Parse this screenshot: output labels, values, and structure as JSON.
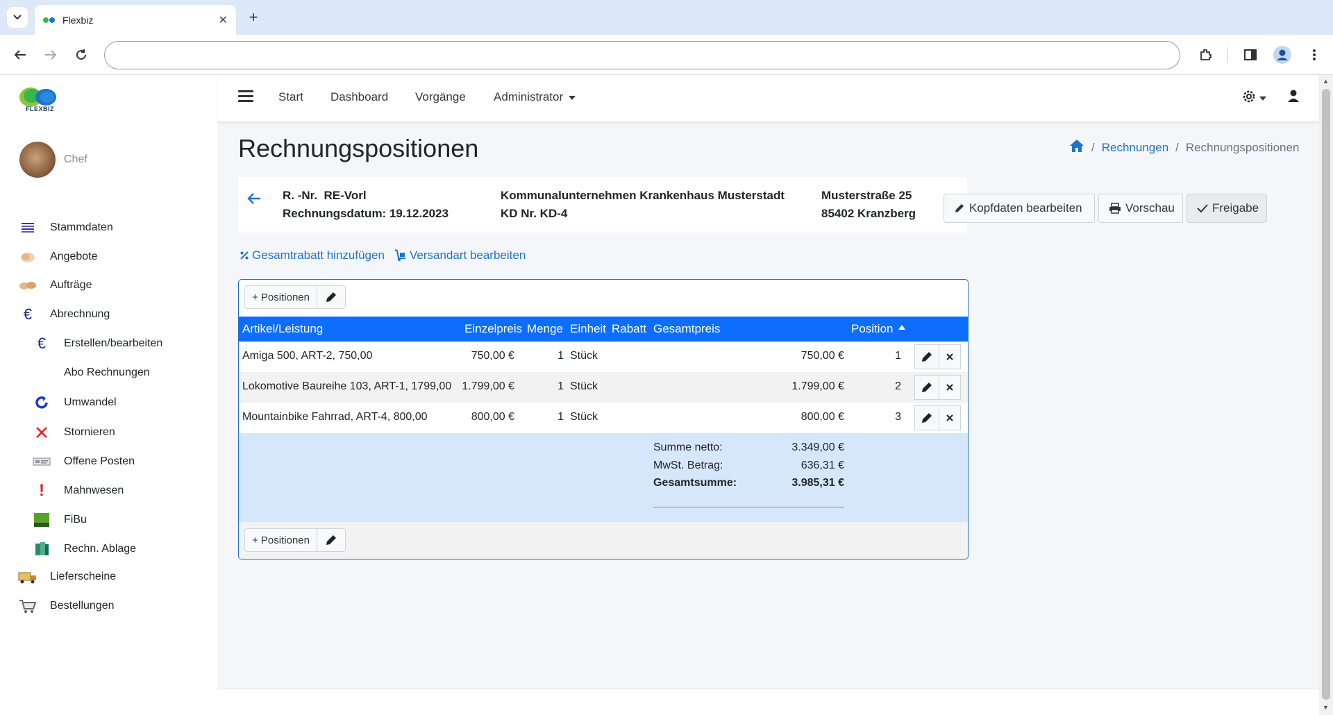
{
  "browser": {
    "tab_title": "Flexbiz",
    "tab_close": "✕",
    "new_tab": "+"
  },
  "app": {
    "logo_text": "FLEXBIZ",
    "user_name": "Chef",
    "sidebar": [
      {
        "label": "Stammdaten",
        "icon": "list-icon"
      },
      {
        "label": "Angebote",
        "icon": "handshake-icon"
      },
      {
        "label": "Aufträge",
        "icon": "deal-icon"
      },
      {
        "label": "Abrechnung",
        "icon": "euro-icon"
      },
      {
        "label": "Erstellen/bearbeiten",
        "icon": "euro-icon"
      },
      {
        "label": "Abo Rechnungen",
        "icon": ""
      },
      {
        "label": "Umwandel",
        "icon": "refresh-icon"
      },
      {
        "label": "Stornieren",
        "icon": "x-icon"
      },
      {
        "label": "Offene Posten",
        "icon": "receipt-icon"
      },
      {
        "label": "Mahnwesen",
        "icon": "exclamation-icon"
      },
      {
        "label": "FiBu",
        "icon": "datev-icon"
      },
      {
        "label": "Rechn. Ablage",
        "icon": "folders-icon"
      },
      {
        "label": "Lieferscheine",
        "icon": "truck-icon"
      },
      {
        "label": "Bestellungen",
        "icon": "cart-icon"
      }
    ],
    "nav": {
      "start": "Start",
      "dashboard": "Dashboard",
      "vorgaenge": "Vorgänge",
      "administrator": "Administrator"
    }
  },
  "page": {
    "title": "Rechnungspositionen",
    "breadcrumb": {
      "sep": "/",
      "rechnungen": "Rechnungen",
      "current": "Rechnungspositionen"
    },
    "invoice": {
      "number_line": "R. -Nr.  RE-Vorl",
      "date_line": "Rechnungsdatum: 19.12.2023",
      "customer_line": "Kommunalunternehmen Krankenhaus Musterstadt",
      "customer_no_line": "KD Nr. KD-4",
      "street": "Musterstraße 25",
      "city": "85402 Kranzberg"
    },
    "buttons": {
      "kopfdaten": "Kopfdaten bearbeiten",
      "vorschau": "Vorschau",
      "freigabe": "Freigabe"
    },
    "links": {
      "gesamtrabatt": "Gesamtrabatt hinzufügen",
      "versandart": "Versandart bearbeiten"
    },
    "table": {
      "add_positions": "+ Positionen",
      "headers": {
        "artikel": "Artikel/Leistung",
        "einzelpreis": "Einzelpreis",
        "menge": "Menge",
        "einheit": "Einheit",
        "rabatt": "Rabatt",
        "gesamtpreis": "Gesamtpreis",
        "position": "Position"
      },
      "rows": [
        {
          "artikel": "Amiga 500, ART-2, 750,00",
          "einzelpreis": "750,00 €",
          "menge": "1",
          "einheit": "Stück",
          "rabatt": "",
          "gesamtpreis": "750,00 €",
          "position": "1"
        },
        {
          "artikel": "Lokomotive Baureihe 103, ART-1, 1799,00",
          "einzelpreis": "1.799,00 €",
          "menge": "1",
          "einheit": "Stück",
          "rabatt": "",
          "gesamtpreis": "1.799,00 €",
          "position": "2"
        },
        {
          "artikel": "Mountainbike Fahrrad, ART-4, 800,00",
          "einzelpreis": "800,00 €",
          "menge": "1",
          "einheit": "Stück",
          "rabatt": "",
          "gesamtpreis": "800,00 €",
          "position": "3"
        }
      ],
      "totals": {
        "netto_label": "Summe netto:",
        "netto_value": "3.349,00 €",
        "mwst_label": "MwSt. Betrag:",
        "mwst_value": "636,31 €",
        "gesamt_label": "Gesamtsumme:",
        "gesamt_value": "3.985,31 €"
      }
    }
  },
  "colors": {
    "primary": "#0d6efd",
    "link": "#1e73c9",
    "totals_bg": "#d6e6fb"
  }
}
